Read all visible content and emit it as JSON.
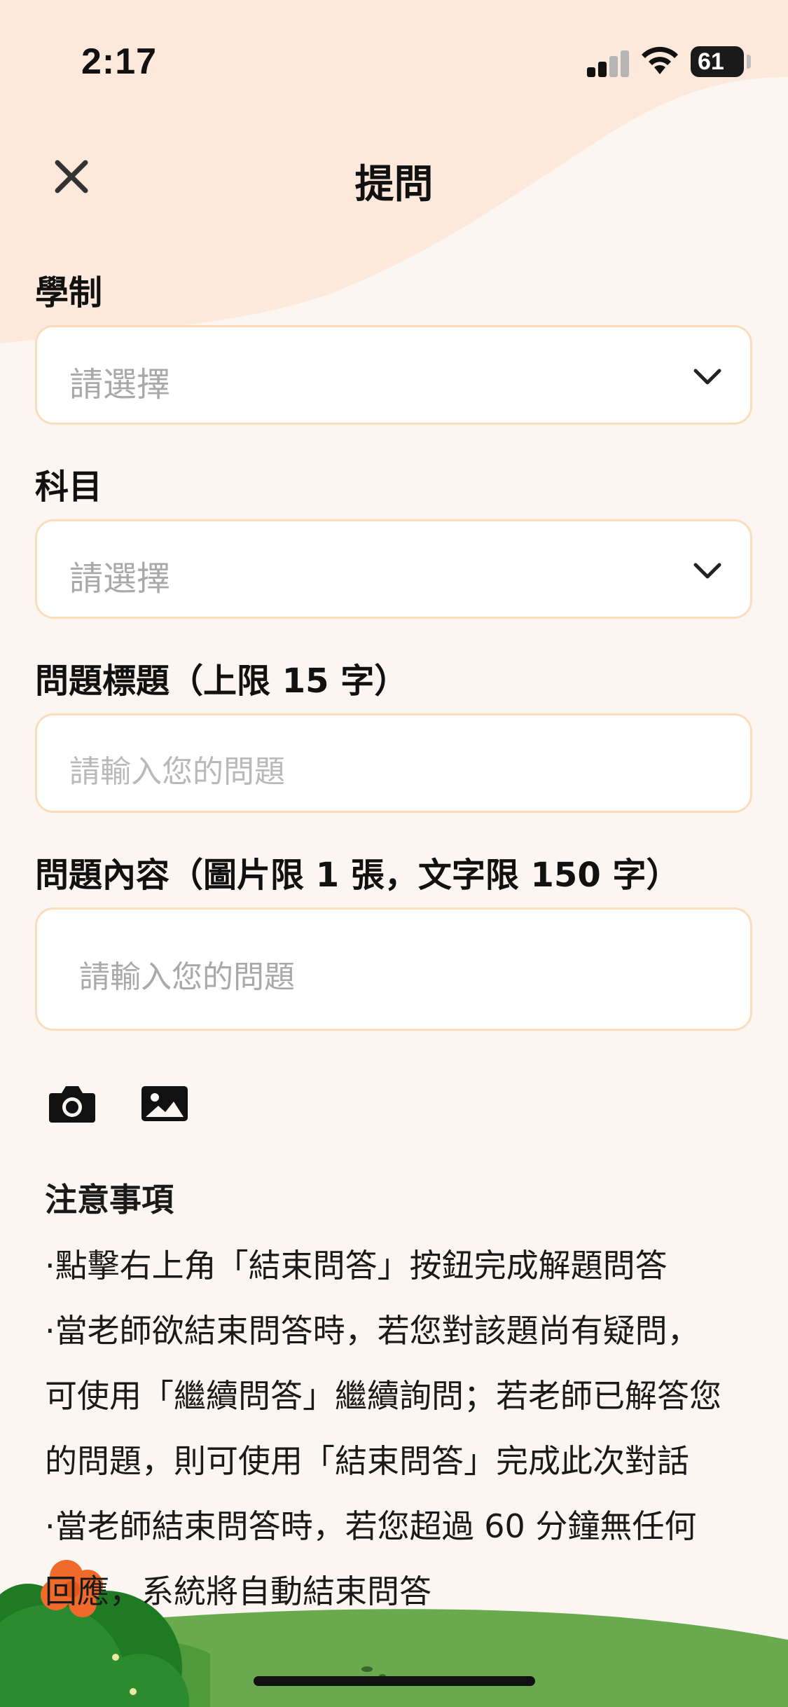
{
  "status_bar": {
    "time": "2:17",
    "battery": "61"
  },
  "nav": {
    "title": "提問",
    "close_icon": "close-icon"
  },
  "form": {
    "school_system": {
      "label": "學制",
      "value": "請選擇"
    },
    "subject": {
      "label": "科目",
      "value": "請選擇"
    },
    "question_title": {
      "label": "問題標題（上限 15 字）",
      "placeholder": "請輸入您的問題"
    },
    "question_content": {
      "label": "問題內容（圖片限 1 張，文字限 150 字）",
      "placeholder": "請輸入您的問題"
    }
  },
  "attachments": {
    "camera_icon": "camera-icon",
    "image_icon": "image-icon"
  },
  "notes": {
    "title": "注意事項",
    "lines": [
      "·點擊右上角「結束問答」按鈕完成解題問答",
      "·當老師欲結束問答時，若您對該題尚有疑問，",
      "可使用「繼續問答」繼續詢問；若老師已解答您",
      "的問題，則可使用「結束問答」完成此次對話",
      "·當老師結束問答時，若您超過 60 分鐘無任何",
      "回應，系統將自動結束問答"
    ]
  },
  "colors": {
    "background": "#fcf6f2",
    "header_peach": "#fde9dc",
    "field_border": "#fbdcbc",
    "placeholder": "#a9a9a9",
    "grass_light": "#6aaa4f",
    "grass_dark": "#1f7a24",
    "flower": "#f06a2c"
  }
}
